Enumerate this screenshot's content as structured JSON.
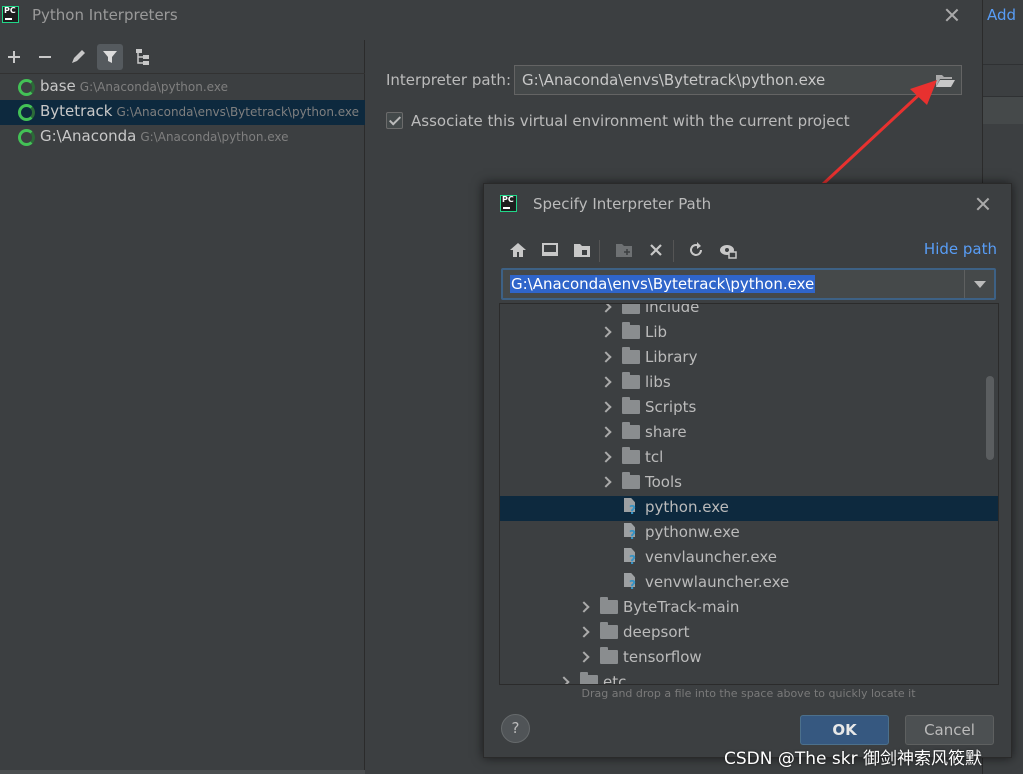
{
  "window": {
    "title": "Python Interpreters",
    "add_link": "Add"
  },
  "interpreters": [
    {
      "name": "base",
      "path": "G:\\Anaconda\\python.exe",
      "selected": false
    },
    {
      "name": "Bytetrack",
      "path": "G:\\Anaconda\\envs\\Bytetrack\\python.exe",
      "selected": true
    },
    {
      "name": "G:\\Anaconda",
      "path": "G:\\Anaconda\\python.exe",
      "selected": false
    }
  ],
  "settings": {
    "interpreter_path_label": "Interpreter path:",
    "interpreter_path_value": "G:\\Anaconda\\envs\\Bytetrack\\python.exe",
    "associate_label": "Associate this virtual environment with the current project",
    "associate_checked": true
  },
  "dialog": {
    "title": "Specify Interpreter Path",
    "hide_path": "Hide path",
    "path_value": "G:\\Anaconda\\envs\\Bytetrack\\python.exe",
    "drag_hint": "Drag and drop a file into the space above to quickly locate it",
    "ok": "OK",
    "cancel": "Cancel",
    "help": "?",
    "tree": [
      {
        "label": "include",
        "kind": "folder",
        "depth": 2,
        "expandable": true
      },
      {
        "label": "Lib",
        "kind": "folder",
        "depth": 2,
        "expandable": true
      },
      {
        "label": "Library",
        "kind": "folder",
        "depth": 2,
        "expandable": true
      },
      {
        "label": "libs",
        "kind": "folder",
        "depth": 2,
        "expandable": true
      },
      {
        "label": "Scripts",
        "kind": "folder",
        "depth": 2,
        "expandable": true
      },
      {
        "label": "share",
        "kind": "folder",
        "depth": 2,
        "expandable": true
      },
      {
        "label": "tcl",
        "kind": "folder",
        "depth": 2,
        "expandable": true
      },
      {
        "label": "Tools",
        "kind": "folder",
        "depth": 2,
        "expandable": true
      },
      {
        "label": "python.exe",
        "kind": "file",
        "depth": 2,
        "expandable": false,
        "selected": true
      },
      {
        "label": "pythonw.exe",
        "kind": "file",
        "depth": 2,
        "expandable": false
      },
      {
        "label": "venvlauncher.exe",
        "kind": "file",
        "depth": 2,
        "expandable": false
      },
      {
        "label": "venvwlauncher.exe",
        "kind": "file",
        "depth": 2,
        "expandable": false
      },
      {
        "label": "ByteTrack-main",
        "kind": "folder",
        "depth": 1,
        "expandable": true
      },
      {
        "label": "deepsort",
        "kind": "folder",
        "depth": 1,
        "expandable": true
      },
      {
        "label": "tensorflow",
        "kind": "folder",
        "depth": 1,
        "expandable": true
      },
      {
        "label": "etc",
        "kind": "folder",
        "depth": 0,
        "expandable": true
      }
    ]
  },
  "watermark": "CSDN @The skr 御剑神索风筱默",
  "colors": {
    "selection": "#0d293e",
    "link": "#589df6",
    "accent_green": "#43c156",
    "arrow": "#e8312f"
  },
  "icons": [
    "pycharm-logo-icon",
    "add-icon",
    "remove-icon",
    "edit-icon",
    "filter-icon",
    "tree-icon",
    "venv-spinner-icon",
    "folder-open-icon",
    "home-icon",
    "desktop-icon",
    "project-folder-icon",
    "new-folder-icon",
    "delete-icon",
    "refresh-icon",
    "show-hidden-icon",
    "close-icon",
    "chevron-down-icon"
  ]
}
